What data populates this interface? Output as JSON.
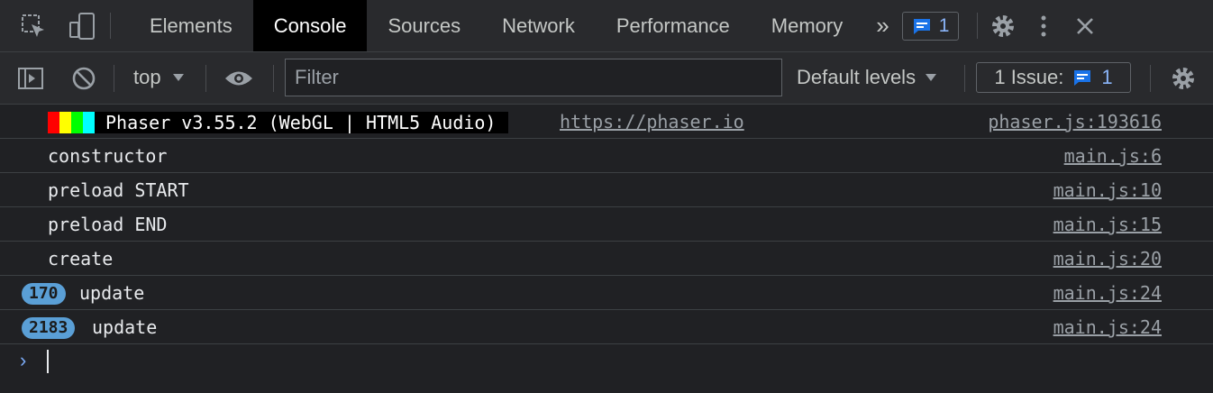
{
  "tabs": {
    "items": [
      {
        "label": "Elements"
      },
      {
        "label": "Console"
      },
      {
        "label": "Sources"
      },
      {
        "label": "Network"
      },
      {
        "label": "Performance"
      },
      {
        "label": "Memory"
      }
    ],
    "active": "Console",
    "more_label": "»",
    "messages_count": "1"
  },
  "toolbar": {
    "context": "top",
    "filter_placeholder": "Filter",
    "levels_label": "Default levels",
    "issues_label": "1 Issue:",
    "issues_count": "1"
  },
  "console": {
    "phaser": {
      "banner": "Phaser v3.55.2 (WebGL | HTML5 Audio)",
      "link": "https://phaser.io",
      "source": "phaser.js:193616",
      "stripe_colors": [
        "#ff0000",
        "#ffff00",
        "#00ff00",
        "#00ffff"
      ]
    },
    "rows": [
      {
        "text": "constructor",
        "source": "main.js:6"
      },
      {
        "text": "preload START",
        "source": "main.js:10"
      },
      {
        "text": "preload END",
        "source": "main.js:15"
      },
      {
        "text": "create",
        "source": "main.js:20"
      }
    ],
    "grouped": [
      {
        "count": "170",
        "text": "update",
        "source": "main.js:24"
      },
      {
        "count": "2183",
        "text": "update",
        "source": "main.js:24"
      }
    ]
  },
  "colors": {
    "background": "#202124",
    "toolbar": "#292a2d",
    "active_tab": "#000000",
    "accent": "#8ab4f8",
    "badge": "#5a9fd6"
  }
}
